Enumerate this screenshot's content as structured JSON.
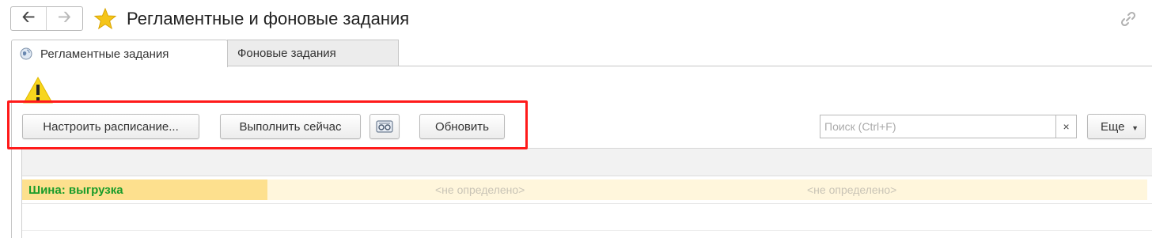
{
  "header": {
    "title": "Регламентные и фоновые задания"
  },
  "tabs": [
    {
      "label": "Регламентные задания",
      "active": true
    },
    {
      "label": "Фоновые задания",
      "active": false
    }
  ],
  "toolbar": {
    "schedule_label": "Настроить расписание...",
    "run_label": "Выполнить сейчас",
    "refresh_label": "Обновить",
    "more_label": "Еще"
  },
  "search": {
    "placeholder": "Поиск (Ctrl+F)",
    "value": "",
    "clear_glyph": "×"
  },
  "table": {
    "rows": [
      {
        "name": "Шина: выгрузка",
        "col2": "<не определено>",
        "col3": "<не определено>"
      }
    ]
  },
  "colors": {
    "highlight": "#ff1a1a",
    "row_name_bg": "#fde08e",
    "row_bg": "#fff6dc",
    "row_name_text": "#1a9c2a",
    "star": "#f5c518"
  },
  "icons": [
    "back-arrow-icon",
    "forward-arrow-icon",
    "star-icon",
    "link-icon",
    "globe-icon",
    "warning-icon",
    "task-icon",
    "chevron-down-icon"
  ]
}
